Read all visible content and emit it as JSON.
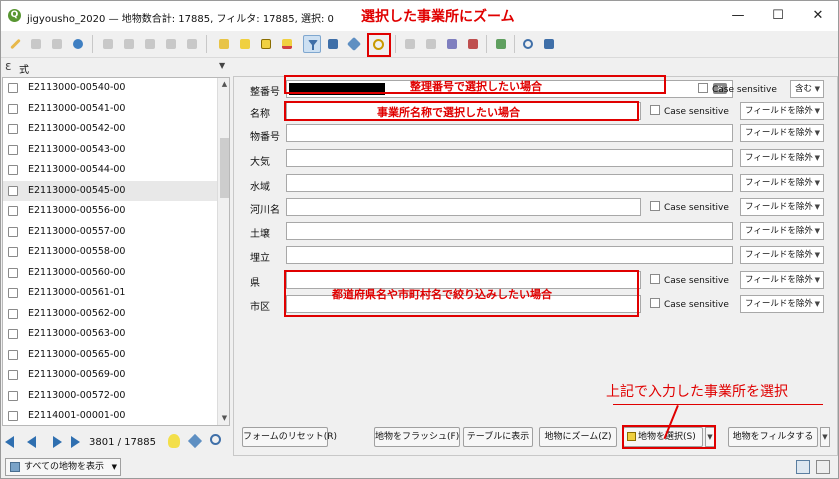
{
  "window": {
    "title": "jigyousho_2020 — 地物数合計: 17885, フィルタ: 17885, 選択: 0",
    "app_icon": "qgis-logo-icon"
  },
  "annotations": {
    "zoom_selected": "選択した事業所にズーム",
    "select_entered": "上記で入力した事業所を選択",
    "id_select": "整理番号で選択したい場合",
    "name_select": "事業所名称で選択したい場合",
    "region_filter": "都道府県名や市町村名で絞り込みしたい場合"
  },
  "left_panel": {
    "expression_label": "式",
    "expression_icon": "epsilon-icon",
    "items": [
      "E2113000-00540-00",
      "E2113000-00541-00",
      "E2113000-00542-00",
      "E2113000-00543-00",
      "E2113000-00544-00",
      "E2113000-00545-00",
      "E2113000-00556-00",
      "E2113000-00557-00",
      "E2113000-00558-00",
      "E2113000-00560-00",
      "E2113000-00561-01",
      "E2113000-00562-00",
      "E2113000-00563-00",
      "E2113000-00565-00",
      "E2113000-00569-00",
      "E2113000-00572-00",
      "E2114001-00001-00"
    ],
    "selected_item_index": 5,
    "nav": {
      "current": "3801",
      "separator": "/",
      "total": "17885",
      "label": "3801 / 17885"
    }
  },
  "form": {
    "fields": [
      {
        "label": "整番号",
        "value": "",
        "option": "Case sensitive",
        "dropdown": "含む"
      },
      {
        "label": "名称",
        "value": "",
        "option": "Case sensitive",
        "dropdown": "フィールドを除外"
      },
      {
        "label": "物番号",
        "value": "",
        "dropdown": "フィールドを除外"
      },
      {
        "label": "大気",
        "value": "",
        "dropdown": "フィールドを除外"
      },
      {
        "label": "水域",
        "value": "",
        "dropdown": "フィールドを除外"
      },
      {
        "label": "河川名",
        "value": "",
        "option": "Case sensitive",
        "dropdown": "フィールドを除外"
      },
      {
        "label": "土壌",
        "value": "",
        "dropdown": "フィールドを除外"
      },
      {
        "label": "埋立",
        "value": "",
        "dropdown": "フィールドを除外"
      },
      {
        "label": "県",
        "value": "",
        "option": "Case sensitive",
        "dropdown": "フィールドを除外"
      },
      {
        "label": "市区",
        "value": "",
        "option": "Case sensitive",
        "dropdown": "フィールドを除外"
      }
    ],
    "buttons": {
      "reset": "フォームのリセット(R)",
      "flash": "地物をフラッシュ(F)",
      "show_table": "テーブルに表示",
      "zoom": "地物にズーム(Z)",
      "select": "地物を選択(S)",
      "filter": "地物をフィルタする"
    }
  },
  "status_bar": {
    "show_all": "すべての地物を表示"
  },
  "colors": {
    "annotation_red": "#e00000",
    "qgis_green": "#589632"
  }
}
